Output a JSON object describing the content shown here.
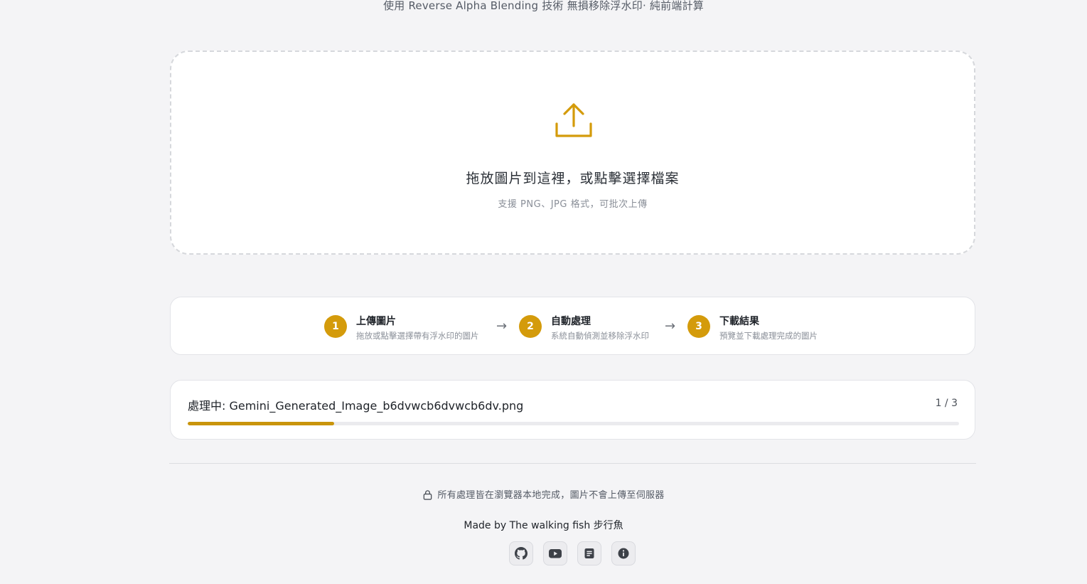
{
  "header": {
    "subtitle": "使用 Reverse Alpha Blending 技術 無損移除浮水印· 純前端計算"
  },
  "dropzone": {
    "icon": "upload-icon",
    "title": "拖放圖片到這裡，或點擊選擇檔案",
    "subtitle": "支援 PNG、JPG 格式，可批次上傳"
  },
  "steps": [
    {
      "number": "1",
      "title": "上傳圖片",
      "desc": "拖放或點擊選擇帶有浮水印的圖片"
    },
    {
      "number": "2",
      "title": "自動處理",
      "desc": "系統自動偵測並移除浮水印"
    },
    {
      "number": "3",
      "title": "下載結果",
      "desc": "預覽並下載處理完成的圖片"
    }
  ],
  "step_arrow": "→",
  "processing": {
    "label": "處理中: Gemini_Generated_Image_b6dvwcb6dvwcb6dv.png",
    "count": "1 / 3",
    "progress_fraction": 0.19
  },
  "footer": {
    "privacy": "所有處理皆在瀏覽器本地完成，圖片不會上傳至伺服器",
    "credit": "Made by The walking fish 步行魚",
    "social_icons": [
      "github-icon",
      "youtube-icon",
      "blog-icon",
      "info-icon"
    ]
  },
  "colors": {
    "accent": "#d49b0b",
    "progress": "#c9940b",
    "background": "#f4f4f6"
  }
}
